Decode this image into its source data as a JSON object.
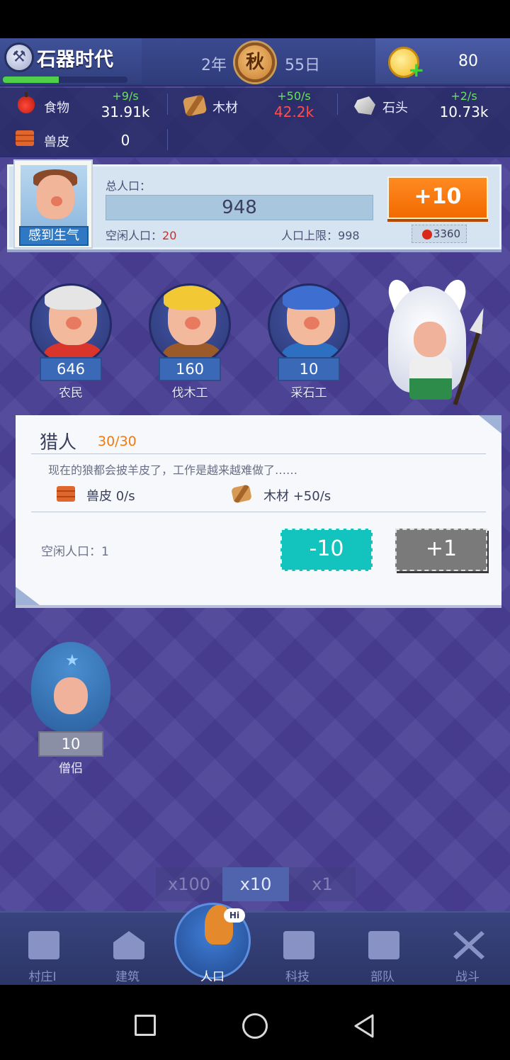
{
  "header": {
    "era": "石器时代",
    "era_progress": 0.45,
    "year": "2年",
    "season": "秋",
    "day": "55日",
    "gold": "80"
  },
  "resources": [
    {
      "name": "食物",
      "rate": "+9/s",
      "amount": "31.91k",
      "icon": "apple-icon"
    },
    {
      "name": "木材",
      "rate": "+50/s",
      "amount": "42.2k",
      "icon": "wood-icon",
      "amount_color": "#ff4d4d"
    },
    {
      "name": "石头",
      "rate": "+2/s",
      "amount": "10.73k",
      "icon": "stone-icon"
    },
    {
      "name": "兽皮",
      "rate": "",
      "amount": "0",
      "icon": "hide-icon"
    }
  ],
  "population": {
    "mood": "感到生气",
    "total_label": "总人口：",
    "total": "948",
    "idle_label": "空闲人口：",
    "idle": "20",
    "cap_label": "人口上限：",
    "cap": "998",
    "add_button": "+10",
    "cost": "3360"
  },
  "workers": [
    {
      "name": "农民",
      "count": "646"
    },
    {
      "name": "伐木工",
      "count": "160"
    },
    {
      "name": "采石工",
      "count": "10"
    }
  ],
  "hunter_card": {
    "title": "猎人",
    "count": "30/30",
    "description": "现在的狼都会披羊皮了，工作是越来越难做了……",
    "prod1": "兽皮 0/s",
    "prod2": "木材 +50/s",
    "idle": "空闲人口：1",
    "minus_button": "-10",
    "plus_button": "+1"
  },
  "monk": {
    "name": "僧侣",
    "count": "10"
  },
  "multiplier": {
    "options": [
      "x100",
      "x10",
      "x1"
    ],
    "selected": "x10"
  },
  "nav": [
    {
      "label": "村庄I",
      "icon": "village-icon"
    },
    {
      "label": "建筑",
      "icon": "building-icon"
    },
    {
      "label": "人口",
      "icon": "population-icon",
      "badge": "Hi"
    },
    {
      "label": "科技",
      "icon": "tech-book-icon"
    },
    {
      "label": "部队",
      "icon": "troops-icon"
    },
    {
      "label": "战斗",
      "icon": "battle-swords-icon"
    }
  ],
  "colors": {
    "accent_orange": "#f26a00",
    "teal_button": "#13c3be",
    "background": "#4a3f96"
  }
}
